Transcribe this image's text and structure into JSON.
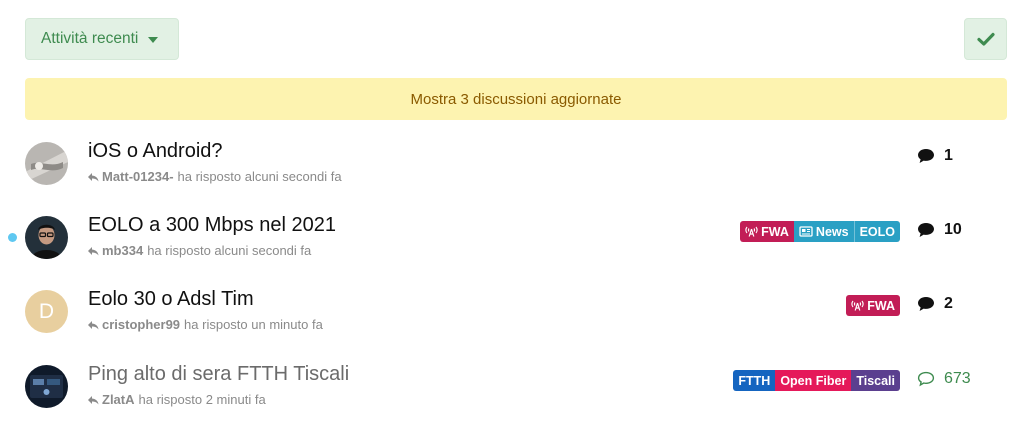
{
  "filter": {
    "label": "Attività recenti"
  },
  "banner": {
    "text": "Mostra 3 discussioni aggiornate"
  },
  "colors": {
    "green": "#3e8b4f",
    "banner_bg": "#fdf3b0",
    "unread": "#5fc8f1"
  },
  "topics": [
    {
      "title": "iOS o Android?",
      "user": "Matt-01234-",
      "action": "ha risposto alcuni secondi fa",
      "replies": "1",
      "unread": false,
      "tags": []
    },
    {
      "title": "EOLO a 300 Mbps nel 2021",
      "user": "mb334",
      "action": "ha risposto alcuni secondi fa",
      "replies": "10",
      "unread": true,
      "tags": [
        {
          "label": "FWA",
          "color": "#c21d56",
          "icon": "antenna-icon"
        },
        {
          "label": "News",
          "color": "#2aa0c4",
          "icon": "newspaper-icon"
        },
        {
          "label": "EOLO",
          "color": "#2aa0c4",
          "icon": ""
        }
      ]
    },
    {
      "title": "Eolo 30 o Adsl Tim",
      "user": "cristopher99",
      "action": "ha risposto un minuto fa",
      "replies": "2",
      "unread": false,
      "avatar_letter": "D",
      "tags": [
        {
          "label": "FWA",
          "color": "#c21d56",
          "icon": "antenna-icon"
        }
      ]
    },
    {
      "title": "Ping alto di sera FTTH Tiscali",
      "user": "ZlatA",
      "action": "ha risposto 2 minuti fa",
      "replies": "673",
      "unread": false,
      "tags": [
        {
          "label": "FTTH",
          "color": "#1565c0",
          "icon": ""
        },
        {
          "label": "Open Fiber",
          "color": "#e5195a",
          "icon": ""
        },
        {
          "label": "Tiscali",
          "color": "#5b3f8f",
          "icon": ""
        }
      ]
    }
  ]
}
